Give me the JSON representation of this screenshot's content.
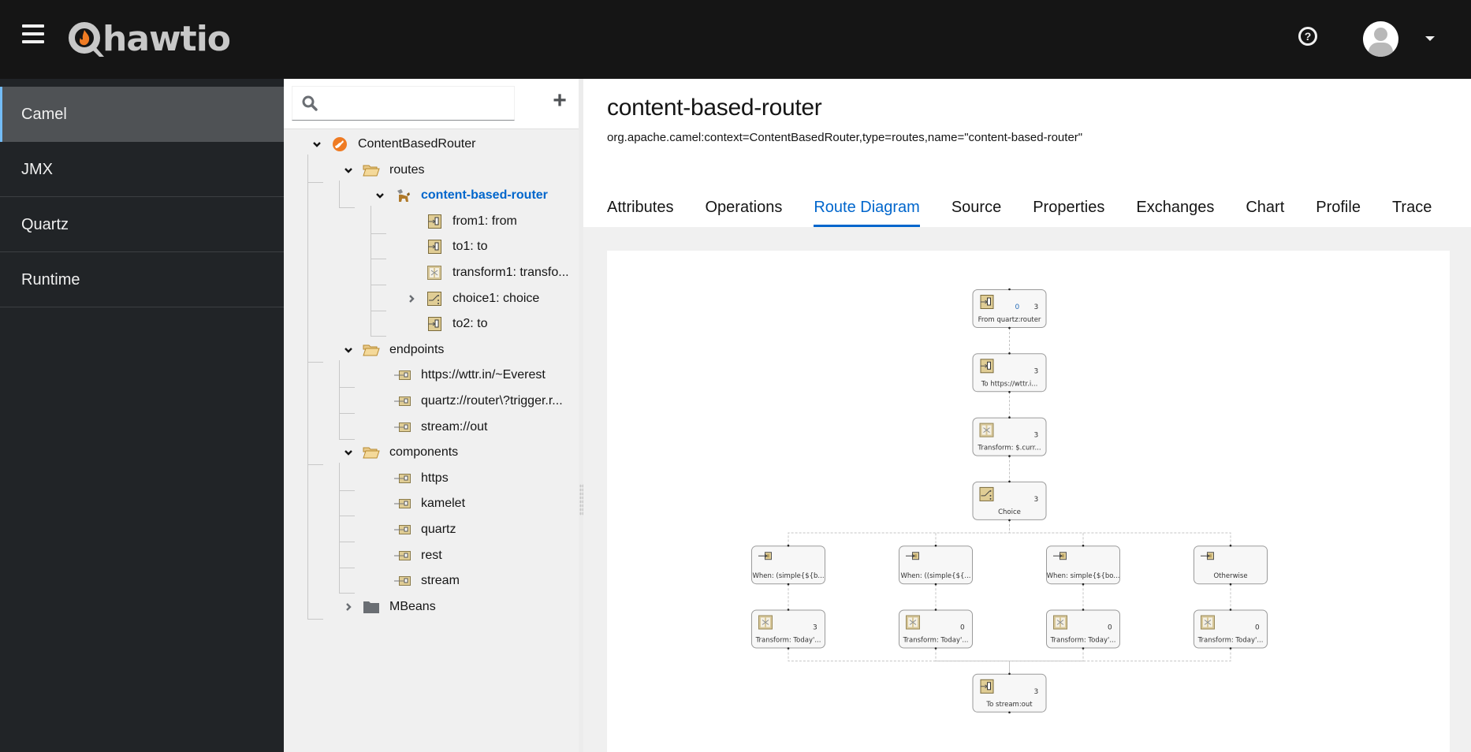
{
  "masthead": {
    "brand": "hawtio",
    "icons": {
      "menu": "hamburger-icon",
      "help": "help-circle-icon",
      "user": "user-avatar-icon",
      "dropdown": "caret-down-icon"
    },
    "help_glyph": "?"
  },
  "sidebar": {
    "items": [
      {
        "label": "Camel",
        "active": true
      },
      {
        "label": "JMX",
        "active": false
      },
      {
        "label": "Quartz",
        "active": false
      },
      {
        "label": "Runtime",
        "active": false
      }
    ]
  },
  "tree": {
    "search": {
      "value": "",
      "placeholder": ""
    },
    "add_label": "+",
    "nodes": [
      {
        "label": "ContentBasedRouter",
        "icon": "camel-context-icon",
        "expanded": true,
        "level": 0
      },
      {
        "label": "routes",
        "icon": "folder-open-icon",
        "expanded": true,
        "level": 1
      },
      {
        "label": "content-based-router",
        "icon": "route-icon",
        "expanded": true,
        "level": 2,
        "selected": true
      },
      {
        "label": "from1: from",
        "icon": "endpoint-icon",
        "level": 3
      },
      {
        "label": "to1: to",
        "icon": "endpoint-icon",
        "level": 3
      },
      {
        "label": "transform1: transfo...",
        "icon": "transform-icon",
        "level": 3
      },
      {
        "label": "choice1: choice",
        "icon": "choice-icon",
        "level": 3,
        "expanded": false
      },
      {
        "label": "to2: to",
        "icon": "endpoint-icon",
        "level": 3
      },
      {
        "label": "endpoints",
        "icon": "folder-open-icon",
        "expanded": true,
        "level": 1
      },
      {
        "label": "https://wttr.in/~Everest",
        "icon": "endpoint-folder-icon",
        "level": 2
      },
      {
        "label": "quartz://router\\?trigger.r...",
        "icon": "endpoint-folder-icon",
        "level": 2
      },
      {
        "label": "stream://out",
        "icon": "endpoint-folder-icon",
        "level": 2
      },
      {
        "label": "components",
        "icon": "folder-open-icon",
        "expanded": true,
        "level": 1
      },
      {
        "label": "https",
        "icon": "component-icon",
        "level": 2
      },
      {
        "label": "kamelet",
        "icon": "component-icon",
        "level": 2
      },
      {
        "label": "quartz",
        "icon": "component-icon",
        "level": 2
      },
      {
        "label": "rest",
        "icon": "component-icon",
        "level": 2
      },
      {
        "label": "stream",
        "icon": "component-icon",
        "level": 2
      },
      {
        "label": "MBeans",
        "icon": "folder-closed-icon",
        "expanded": false,
        "level": 1
      }
    ]
  },
  "main": {
    "title": "content-based-router",
    "object_name": "org.apache.camel:context=ContentBasedRouter,type=routes,name=\"content-based-router\"",
    "tabs": [
      {
        "label": "Attributes",
        "active": false
      },
      {
        "label": "Operations",
        "active": false
      },
      {
        "label": "Route Diagram",
        "active": true
      },
      {
        "label": "Source",
        "active": false
      },
      {
        "label": "Properties",
        "active": false
      },
      {
        "label": "Exchanges",
        "active": false
      },
      {
        "label": "Chart",
        "active": false
      },
      {
        "label": "Profile",
        "active": false
      },
      {
        "label": "Trace",
        "active": false
      }
    ]
  },
  "diagram": {
    "nodes": [
      {
        "id": "from",
        "label": "From quartz:router",
        "icon": "endpoint-icon",
        "inflight": "0",
        "total": "3",
        "col": 1.5,
        "row": 0
      },
      {
        "id": "to1",
        "label": "To https://wttr.i...",
        "icon": "endpoint-icon",
        "total": "3",
        "col": 1.5,
        "row": 1
      },
      {
        "id": "transform1",
        "label": "Transform: $.curr...",
        "icon": "transform-icon",
        "total": "3",
        "col": 1.5,
        "row": 2
      },
      {
        "id": "choice",
        "label": "Choice",
        "icon": "choice-icon",
        "total": "3",
        "col": 1.5,
        "row": 3
      },
      {
        "id": "when1",
        "label": "When: (simple{${b...",
        "icon": "when-icon",
        "col": 0,
        "row": 4
      },
      {
        "id": "when2",
        "label": "When: ((simple{${...",
        "icon": "when-icon",
        "col": 1,
        "row": 4
      },
      {
        "id": "when3",
        "label": "When: simple{${bo...",
        "icon": "when-icon",
        "col": 2,
        "row": 4
      },
      {
        "id": "otherwise",
        "label": "Otherwise",
        "icon": "when-icon",
        "col": 3,
        "row": 4
      },
      {
        "id": "t1",
        "label": "Transform: Today'...",
        "icon": "transform-icon",
        "total": "3",
        "col": 0,
        "row": 5
      },
      {
        "id": "t2",
        "label": "Transform: Today'...",
        "icon": "transform-icon",
        "total": "0",
        "col": 1,
        "row": 5
      },
      {
        "id": "t3",
        "label": "Transform: Today'...",
        "icon": "transform-icon",
        "total": "0",
        "col": 2,
        "row": 5
      },
      {
        "id": "t4",
        "label": "Transform: Today'...",
        "icon": "transform-icon",
        "total": "0",
        "col": 3,
        "row": 5
      },
      {
        "id": "to2",
        "label": "To stream:out",
        "icon": "endpoint-icon",
        "total": "3",
        "col": 1.5,
        "row": 6
      }
    ],
    "edges": [
      [
        "from",
        "to1"
      ],
      [
        "to1",
        "transform1"
      ],
      [
        "transform1",
        "choice"
      ],
      [
        "choice",
        "when1"
      ],
      [
        "choice",
        "when2"
      ],
      [
        "choice",
        "when3"
      ],
      [
        "choice",
        "otherwise"
      ],
      [
        "when1",
        "t1"
      ],
      [
        "when2",
        "t2"
      ],
      [
        "when3",
        "t3"
      ],
      [
        "otherwise",
        "t4"
      ],
      [
        "t1",
        "to2"
      ],
      [
        "t2",
        "to2"
      ],
      [
        "t3",
        "to2"
      ],
      [
        "t4",
        "to2"
      ]
    ]
  }
}
